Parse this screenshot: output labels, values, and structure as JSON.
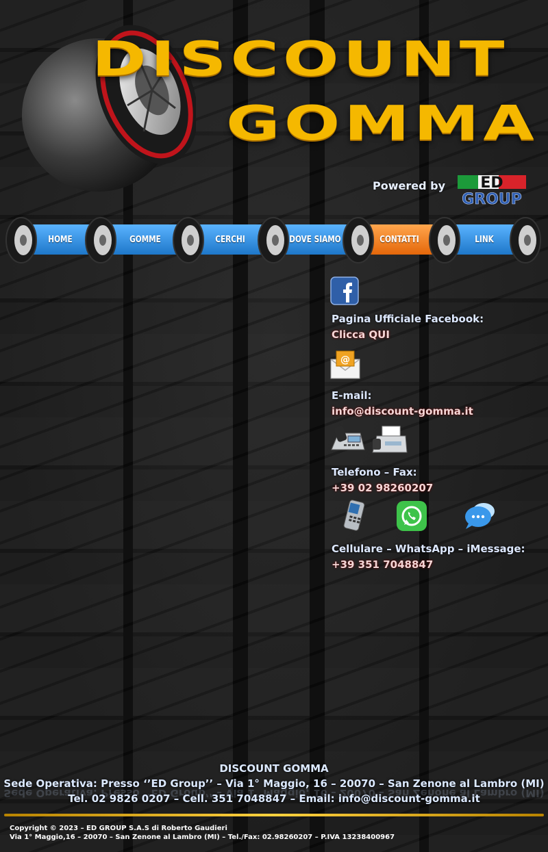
{
  "header": {
    "title_line1": "DISCOUNT",
    "title_line2": "GOMMA",
    "powered_by": "Powered by",
    "ed_logo_top": "ED",
    "ed_logo_bottom": "GROUP"
  },
  "nav": {
    "items": [
      {
        "label": "HOME",
        "active": false
      },
      {
        "label": "GOMME",
        "active": false
      },
      {
        "label": "CERCHI",
        "active": false
      },
      {
        "label": "DOVE SIAMO",
        "active": false
      },
      {
        "label": "CONTATTI",
        "active": true
      },
      {
        "label": "LINK",
        "active": false
      }
    ],
    "colors": {
      "normal": "#2c8ee0",
      "active": "#f07a12"
    }
  },
  "contact": {
    "facebook": {
      "icon": "facebook-icon",
      "label": "Pagina Ufficiale Facebook:",
      "value": "Clicca QUI"
    },
    "email": {
      "icon": "mail-icon",
      "label": "E-mail:",
      "value": "info@discount-gomma.it"
    },
    "phone": {
      "icons": [
        "desk-phone-icon",
        "fax-icon"
      ],
      "label": "Telefono – Fax:",
      "value": "+39 02 98260207"
    },
    "mobile": {
      "icons": [
        "mobile-phone-icon",
        "whatsapp-icon",
        "imessage-icon"
      ],
      "label": "Cellulare – WhatsApp – iMessage:",
      "value": "+39 351 7048847"
    }
  },
  "footer": {
    "company": "DISCOUNT GOMMA",
    "address": "Sede Operativa: Presso ‘’ED Group’’ – Via 1° Maggio, 16 – 20070 – San Zenone al Lambro (MI)",
    "contacts": "Tel. 02 9826 0207 – Cell. 351 7048847 – Email: info@discount-gomma.it",
    "copyright_line1": "Copyright  © 2023 – ED GROUP  S.A.S  di Roberto Gaudieri",
    "copyright_line2": "Via 1° Maggio,16 – 20070 – San Zenone al Lambro (MI) – Tel./Fax:  02.98260207 – P.IVA 13238400967"
  }
}
